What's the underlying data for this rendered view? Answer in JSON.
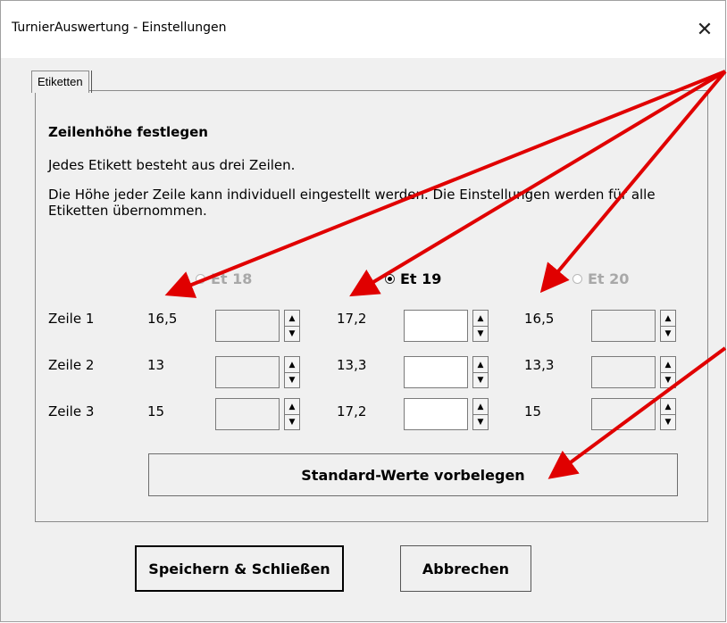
{
  "window": {
    "title": "TurnierAuswertung - Einstellungen",
    "close_symbol": "✕"
  },
  "tab": {
    "label": "Etiketten"
  },
  "section": {
    "heading": "Zeilenhöhe festlegen",
    "line1": "Jedes Etikett besteht aus drei Zeilen.",
    "paragraph": "Die Höhe jeder Zeile kann individuell eingestellt werden. Die Einstellungen werden für alle Etiketten übernommen."
  },
  "columns": [
    {
      "label": "Et 18",
      "checked": false,
      "enabled": false,
      "values": [
        "16,5",
        "13",
        "15"
      ]
    },
    {
      "label": "Et 19",
      "checked": true,
      "enabled": true,
      "values": [
        "17,2",
        "13,3",
        "17,2"
      ]
    },
    {
      "label": "Et 20",
      "checked": false,
      "enabled": false,
      "values": [
        "16,5",
        "13,3",
        "15"
      ]
    }
  ],
  "rows": [
    "Zeile 1",
    "Zeile 2",
    "Zeile 3"
  ],
  "spinner": {
    "up": "▲",
    "down": "▼"
  },
  "buttons": {
    "standard": "Standard-Werte vorbelegen",
    "save": "Speichern & Schließen",
    "cancel": "Abbrechen"
  },
  "colors": {
    "annotation_arrow": "#e00000",
    "disabled_text": "#a8a8a8",
    "dialog_bg": "#f0f0f0"
  }
}
